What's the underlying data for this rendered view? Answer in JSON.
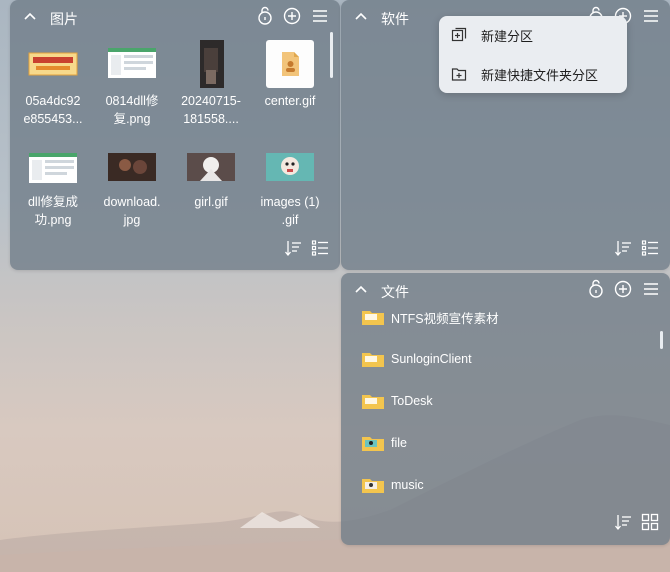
{
  "colors": {
    "fence_bg": "#707c88",
    "menu_bg": "#eaedf1",
    "folder": "#f3c54e"
  },
  "pictures_fence": {
    "title": "图片",
    "items": [
      {
        "label": "05a4dc92\ne855453...",
        "thumb": "banner-image"
      },
      {
        "label": "0814dll修\n复.png",
        "thumb": "screenshot-image"
      },
      {
        "label": "20240715-\n181558....",
        "thumb": "portrait-photo"
      },
      {
        "label": "center.gif",
        "thumb": "gif-file-icon"
      },
      {
        "label": "dll修复成\n功.png",
        "thumb": "screenshot-image"
      },
      {
        "label": "download.\njpg",
        "thumb": "dark-photo"
      },
      {
        "label": "girl.gif",
        "thumb": "anime-image"
      },
      {
        "label": "images (1)\n.gif",
        "thumb": "cartoon-image"
      }
    ]
  },
  "software_fence": {
    "title": "软件"
  },
  "files_fence": {
    "title": "文件",
    "items": [
      {
        "label": "NTFS视频宣传素材"
      },
      {
        "label": "SunloginClient"
      },
      {
        "label": "ToDesk"
      },
      {
        "label": "file"
      },
      {
        "label": "music"
      }
    ]
  },
  "context_menu": {
    "items": [
      {
        "label": "新建分区",
        "icon": "new-partition-icon"
      },
      {
        "label": "新建快捷文件夹分区",
        "icon": "new-folder-partition-icon"
      }
    ]
  }
}
